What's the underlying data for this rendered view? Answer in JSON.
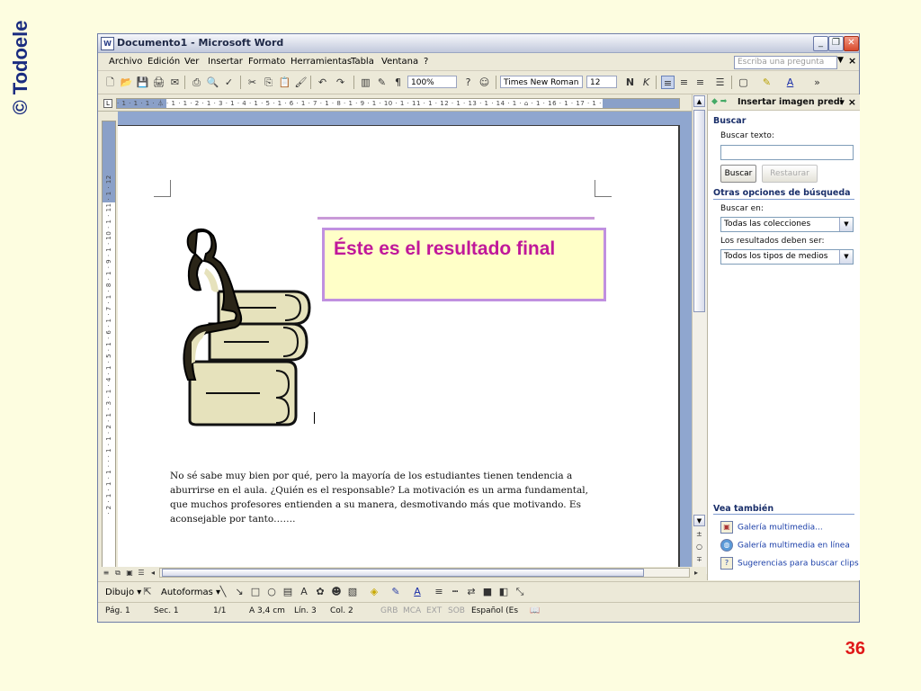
{
  "watermark": "© Todoele",
  "slide_number": "36",
  "window": {
    "title": "Documento1 - Microsoft Word",
    "icon": "word-icon"
  },
  "menu": {
    "items": [
      "Archivo",
      "Edición",
      "Ver",
      "Insertar",
      "Formato",
      "Herramientas",
      "Tabla",
      "Ventana",
      "?"
    ],
    "ask_placeholder": "Escriba una pregunta"
  },
  "toolbar": {
    "zoom": "100%",
    "font": "Times New Roman",
    "size": "12",
    "bold": "N",
    "italic": "K"
  },
  "document": {
    "callout_text": "Éste es el resultado final",
    "body_text": "No sé sabe muy bien por qué, pero la mayoría de los estudiantes tienen tendencia a aburrirse en el aula. ¿Quién es el responsable? La motivación es un arma fundamental, que muchos profesores entienden a su manera, desmotivando más que motivando. Es aconsejable por tanto……."
  },
  "rulers": {
    "horizontal": "· 1 · 1 · 1 · ⏃ · 1 · 1 · 2 · 1 · 3 · 1 · 4 · 1 · 5 · 1 · 6 · 1 · 7 · 1 · 8 · 1 · 9 · 1 · 10 · 1 · 11 · 1 · 12 · 1 · 13 · 1 · 14 · 1 · ⌂ · 1 · 16 · 1 · 17 · 1 ·",
    "vertical": "· 2 · 1 · 1 · 1 · · · 1 · 1 · 2 · 1 · 3 · 1 · 4 · 1 · 5 · 1 · 6 · 1 · 7 · 1 · 8 · 1 · 9 · 1 · 10 · 1 · 11 · 1 · 12"
  },
  "task_pane": {
    "title": "Insertar imagen predi",
    "search_heading": "Buscar",
    "search_label": "Buscar texto:",
    "search_value": "",
    "search_button": "Buscar",
    "restore_button": "Restaurar",
    "other_heading": "Otras opciones de búsqueda",
    "search_in_label": "Buscar en:",
    "search_in_value": "Todas las colecciones",
    "results_label": "Los resultados deben ser:",
    "results_value": "Todos los tipos de medios",
    "see_also_heading": "Vea también",
    "links": [
      "Galería multimedia...",
      "Galería multimedia en línea",
      "Sugerencias para buscar clips"
    ]
  },
  "drawing_toolbar": {
    "draw": "Dibujo",
    "autoshapes": "Autoformas"
  },
  "status": {
    "page": "Pág. 1",
    "section": "Sec. 1",
    "pages": "1/1",
    "at": "A 3,4 cm",
    "line": "Lín. 3",
    "col": "Col. 2",
    "grb": "GRB",
    "mca": "MCA",
    "ext": "EXT",
    "sob": "SOB",
    "language": "Español (Es"
  },
  "colors": {
    "slide_background": "#fdfde0",
    "callout_text": "#c0189a",
    "callout_border": "#c090e0",
    "callout_fill": "#ffffc8",
    "watermark": "#1a2c80",
    "slide_number": "#e01818"
  }
}
